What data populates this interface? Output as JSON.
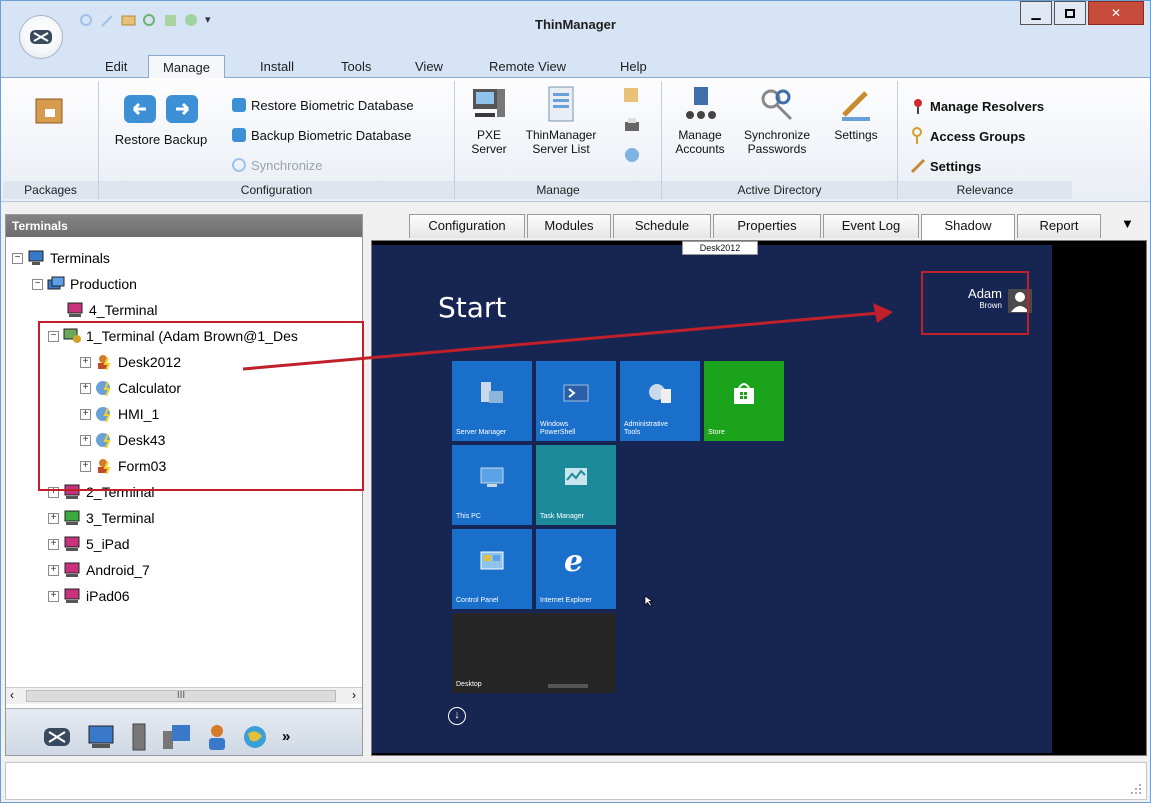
{
  "window": {
    "title": "ThinManager"
  },
  "menu_tabs": [
    "Edit",
    "Manage",
    "Install",
    "Tools",
    "View",
    "Remote View",
    "Help"
  ],
  "ribbon": {
    "packages": {
      "group_label": "Packages"
    },
    "configuration": {
      "restore_backup": "Restore Backup",
      "restore_biometric": "Restore Biometric Database",
      "backup_biometric": "Backup Biometric Database",
      "synchronize": "Synchronize",
      "group_label": "Configuration"
    },
    "manage": {
      "pxe_line1": "PXE",
      "pxe_line2": "Server",
      "server_list_line1": "ThinManager",
      "server_list_line2": "Server List",
      "group_label": "Manage"
    },
    "active_directory": {
      "manage_accounts_line1": "Manage",
      "manage_accounts_line2": "Accounts",
      "sync_passwords_line1": "Synchronize",
      "sync_passwords_line2": "Passwords",
      "settings": "Settings",
      "group_label": "Active Directory"
    },
    "relevance": {
      "manage_resolvers": "Manage Resolvers",
      "access_groups": "Access Groups",
      "settings": "Settings",
      "group_label": "Relevance"
    }
  },
  "left_panel": {
    "header": "Terminals",
    "tree": {
      "root": "Terminals",
      "production": "Production",
      "terminal4": "4_Terminal",
      "terminal1": "1_Terminal (Adam Brown@1_Des",
      "desk2012": "Desk2012",
      "calculator": "Calculator",
      "hmi1": "HMI_1",
      "desk43": "Desk43",
      "form03": "Form03",
      "terminal2": "2_Terminal",
      "terminal3": "3_Terminal",
      "ipad5": "5_iPad",
      "android7": "Android_7",
      "ipad06": "iPad06"
    },
    "scroll_grip": "III",
    "more_glyph": "»"
  },
  "right_tabs": [
    "Configuration",
    "Modules",
    "Schedule",
    "Properties",
    "Event Log",
    "Shadow",
    "Report"
  ],
  "active_right_tab": "Shadow",
  "shadow": {
    "session_label": "Desk2012",
    "start_text": "Start",
    "user_first": "Adam",
    "user_last": "Brown",
    "tiles": {
      "server_manager": "Server Manager",
      "powershell_1": "Windows",
      "powershell_2": "PowerShell",
      "admin_tools_1": "Administrative",
      "admin_tools_2": "Tools",
      "store": "Store",
      "this_pc": "This PC",
      "task_manager": "Task Manager",
      "control_panel": "Control Panel",
      "internet_explorer": "Internet Explorer",
      "desktop": "Desktop"
    }
  },
  "colors": {
    "highlight_red": "#c0202a",
    "tile_blue": "#1a6fcb",
    "tile_green": "#1ca31c",
    "tile_teal": "#1d8a9c",
    "start_background": "#172552"
  }
}
